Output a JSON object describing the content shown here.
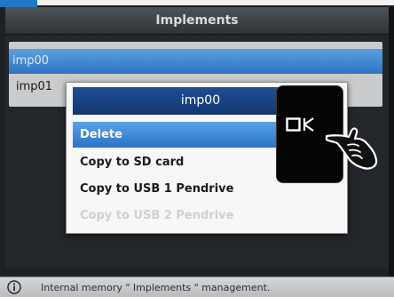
{
  "title": "Implements",
  "list": {
    "items": [
      "imp00",
      "imp01"
    ],
    "selected_index": 0
  },
  "popup": {
    "title": "imp00",
    "items": [
      {
        "label": "Delete",
        "state": "highlighted"
      },
      {
        "label": "Copy to SD card",
        "state": "enabled"
      },
      {
        "label": "Copy to USB 1 Pendrive",
        "state": "enabled"
      },
      {
        "label": "Copy to USB 2 Pendrive",
        "state": "disabled"
      }
    ]
  },
  "ok_key": {
    "label": "OK"
  },
  "status": {
    "icon": "info-icon",
    "text": "Internal memory \" Implements \" management."
  },
  "colors": {
    "accent_blue": "#2f74c2",
    "popup_title": "#123670",
    "background": "#1e2124"
  }
}
